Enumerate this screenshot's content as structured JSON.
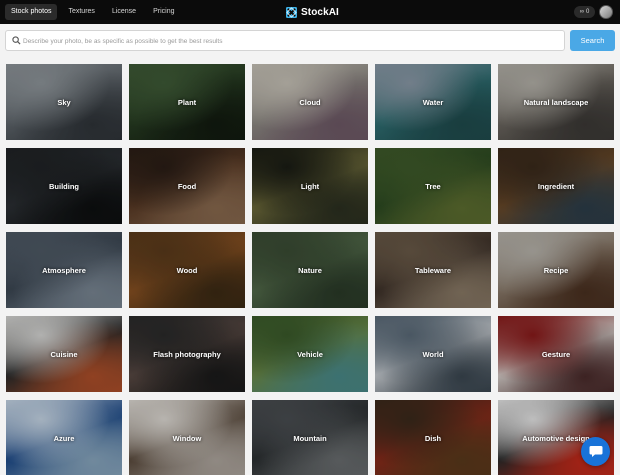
{
  "nav": {
    "items": [
      {
        "label": "Stock photos",
        "active": true
      },
      {
        "label": "Textures",
        "active": false
      },
      {
        "label": "License",
        "active": false
      },
      {
        "label": "Pricing",
        "active": false
      }
    ]
  },
  "brand": {
    "name": "StockAI",
    "logo_icon": "stockai-logo-icon"
  },
  "account": {
    "credits_icon": "infinity-icon",
    "credits_count": "0",
    "avatar_icon": "user-avatar"
  },
  "search": {
    "icon": "search-icon",
    "placeholder": "Describe your photo, be as specific as possible to get the best results",
    "value": "",
    "button_label": "Search",
    "button_color": "#4aa8e6"
  },
  "categories": [
    {
      "label": "Sky",
      "palette": [
        "#8f969b",
        "#5f666c",
        "#2f3439"
      ]
    },
    {
      "label": "Plant",
      "palette": [
        "#3f5b37",
        "#273c22",
        "#121b10"
      ]
    },
    {
      "label": "Cloud",
      "palette": [
        "#c8c3b8",
        "#8e8a84",
        "#6e5966"
      ]
    },
    {
      "label": "Water",
      "palette": [
        "#8b9aa8",
        "#2f6f73",
        "#1f4b4d"
      ]
    },
    {
      "label": "Natural landscape",
      "palette": [
        "#b5b2aa",
        "#6c6760",
        "#3c3936"
      ]
    },
    {
      "label": "Building",
      "palette": [
        "#202326",
        "#2c3034",
        "#0d0f10"
      ]
    },
    {
      "label": "Food",
      "palette": [
        "#2a1d16",
        "#5a3b26",
        "#8a6a4f"
      ]
    },
    {
      "label": "Light",
      "palette": [
        "#1a1c14",
        "#6d6a3a",
        "#2b2f20"
      ]
    },
    {
      "label": "Tree",
      "palette": [
        "#3e5a2a",
        "#2c4a22",
        "#5d6e30"
      ]
    },
    {
      "label": "Ingredient",
      "palette": [
        "#3a2a1c",
        "#6a4a2a",
        "#2c3e4a"
      ]
    },
    {
      "label": "Atmosphere",
      "palette": [
        "#4f5a66",
        "#3b4652",
        "#7a8794"
      ]
    },
    {
      "label": "Wood",
      "palette": [
        "#5a3a1c",
        "#8a5222",
        "#3c2a14"
      ]
    },
    {
      "label": "Nature",
      "palette": [
        "#3a4c34",
        "#526a4a",
        "#2a3a28"
      ]
    },
    {
      "label": "Tableware",
      "palette": [
        "#6a5a48",
        "#3c3028",
        "#8a7a66"
      ]
    },
    {
      "label": "Recipe",
      "palette": [
        "#b8b4ac",
        "#8a7a6a",
        "#4a3020"
      ]
    },
    {
      "label": "Cuisine",
      "palette": [
        "#d8d8d6",
        "#2a2a2a",
        "#b0502a"
      ]
    },
    {
      "label": "Flash photography",
      "palette": [
        "#2a2a2a",
        "#5a4a44",
        "#1a1a1a"
      ]
    },
    {
      "label": "Vehicle",
      "palette": [
        "#3a5a2a",
        "#6a8a4a",
        "#4a8a8a"
      ]
    },
    {
      "label": "World",
      "palette": [
        "#5a6a78",
        "#c8cdd2",
        "#3a4650"
      ]
    },
    {
      "label": "Gesture",
      "palette": [
        "#8a1a1a",
        "#d8d0cc",
        "#4a2a2a"
      ]
    },
    {
      "label": "Azure",
      "palette": [
        "#c8d8e8",
        "#1c4a8a",
        "#8aa8c0"
      ]
    },
    {
      "label": "Window",
      "palette": [
        "#e0dcd6",
        "#5a4a3c",
        "#b0a8a0"
      ]
    },
    {
      "label": "Mountain",
      "palette": [
        "#4a4e52",
        "#2a2e30",
        "#6a6e70"
      ]
    },
    {
      "label": "Dish",
      "palette": [
        "#3a2a1c",
        "#8a2a1a",
        "#5a3a1c"
      ]
    },
    {
      "label": "Automotive design",
      "palette": [
        "#e8e8e8",
        "#2a2a2a",
        "#c82a1a"
      ]
    }
  ],
  "chat": {
    "icon": "chat-bubble-icon",
    "color": "#1973d8"
  }
}
